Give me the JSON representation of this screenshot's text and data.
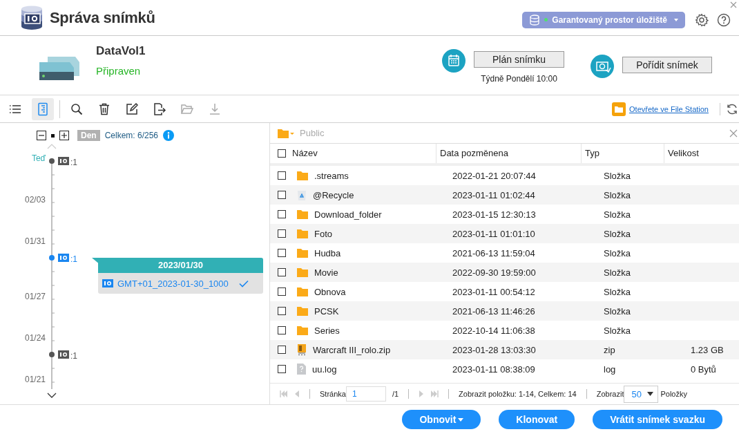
{
  "window": {
    "title": "Správa snímků"
  },
  "storage_button": {
    "label": "Garantovaný prostor úložiště"
  },
  "volume": {
    "name": "DataVol1",
    "status": "Připraven"
  },
  "schedule": {
    "button": "Plán snímku",
    "note": "Týdně Pondělí 10:00"
  },
  "take_snapshot": {
    "button": "Pořídit snímek"
  },
  "toolbar": {
    "tools": [
      {
        "kind": "list",
        "selected": false,
        "disabled": false
      },
      {
        "kind": "timeline",
        "selected": true,
        "disabled": false
      },
      {
        "kind": "search",
        "selected": false,
        "disabled": false
      },
      {
        "kind": "delete",
        "selected": false,
        "disabled": false
      },
      {
        "kind": "edit",
        "selected": false,
        "disabled": false
      },
      {
        "kind": "export",
        "selected": false,
        "disabled": false
      },
      {
        "kind": "open",
        "selected": false,
        "disabled": true
      },
      {
        "kind": "download",
        "selected": false,
        "disabled": true
      }
    ],
    "file_station_link": "Otevřete ve File Station"
  },
  "timeline": {
    "scale": "Den",
    "total": "Celkem: 6/256",
    "dates": [
      {
        "label": "Teď",
        "kind": "now"
      },
      {
        "label": "02/03",
        "kind": "date"
      },
      {
        "label": "01/31",
        "kind": "date"
      },
      {
        "label": "01/27",
        "kind": "date"
      },
      {
        "label": "01/24",
        "kind": "date"
      },
      {
        "label": "01/21",
        "kind": "date"
      }
    ],
    "snapshots": [
      {
        "count": ":1",
        "selected": false
      },
      {
        "count": ":1",
        "selected": true
      },
      {
        "count": ":1",
        "selected": false
      }
    ],
    "popup": {
      "date": "2023/01/30",
      "snapshots": [
        {
          "name": "GMT+01_2023-01-30_1000",
          "checked": true
        }
      ]
    }
  },
  "browser": {
    "path": "Public",
    "all_checked": false,
    "columns": [
      "Název",
      "Data pozměnena",
      "Typ",
      "Velikost"
    ],
    "rows": [
      {
        "kind": "folder",
        "checked": false,
        "name": ".streams",
        "modified": "2022-01-21 20:07:44",
        "type": "Složka"
      },
      {
        "kind": "recycle",
        "checked": false,
        "name": "@Recycle",
        "modified": "2023-01-11 01:02:44",
        "type": "Složka"
      },
      {
        "kind": "folder",
        "checked": false,
        "name": "Download_folder",
        "modified": "2023-01-15 12:30:13",
        "type": "Složka"
      },
      {
        "kind": "folder",
        "checked": false,
        "name": "Foto",
        "modified": "2023-01-11 01:01:10",
        "type": "Složka"
      },
      {
        "kind": "folder",
        "checked": false,
        "name": "Hudba",
        "modified": "2021-06-13 11:59:04",
        "type": "Složka"
      },
      {
        "kind": "folder",
        "checked": false,
        "name": "Movie",
        "modified": "2022-09-30 19:59:00",
        "type": "Složka"
      },
      {
        "kind": "folder",
        "checked": false,
        "name": "Obnova",
        "modified": "2023-01-11 00:54:12",
        "type": "Složka"
      },
      {
        "kind": "folder",
        "checked": false,
        "name": "PCSK",
        "modified": "2021-06-13 11:46:26",
        "type": "Složka"
      },
      {
        "kind": "folder",
        "checked": false,
        "name": "Series",
        "modified": "2022-10-14 11:06:38",
        "type": "Složka"
      },
      {
        "kind": "zip",
        "checked": false,
        "name": "Warcraft III_rolo.zip",
        "modified": "2023-01-28 13:03:30",
        "type": "zip",
        "size": "1.23 GB"
      },
      {
        "kind": "file",
        "checked": false,
        "name": "uu.log",
        "modified": "2023-01-11 08:38:09",
        "type": "log",
        "size": "0 Bytů"
      }
    ],
    "pagination": {
      "page_label": "Stránka",
      "page": "1",
      "page_total": "/1",
      "summary": "Zobrazit položku: 1-14, Celkem: 14",
      "show_label": "Zobrazit",
      "per_page": "50",
      "items_label": "Položky"
    }
  },
  "actions": [
    {
      "label": "Obnovit",
      "dropdown": true
    },
    {
      "label": "Klonovat",
      "dropdown": false
    },
    {
      "label": "Vrátit snímek svazku",
      "dropdown": false
    }
  ]
}
